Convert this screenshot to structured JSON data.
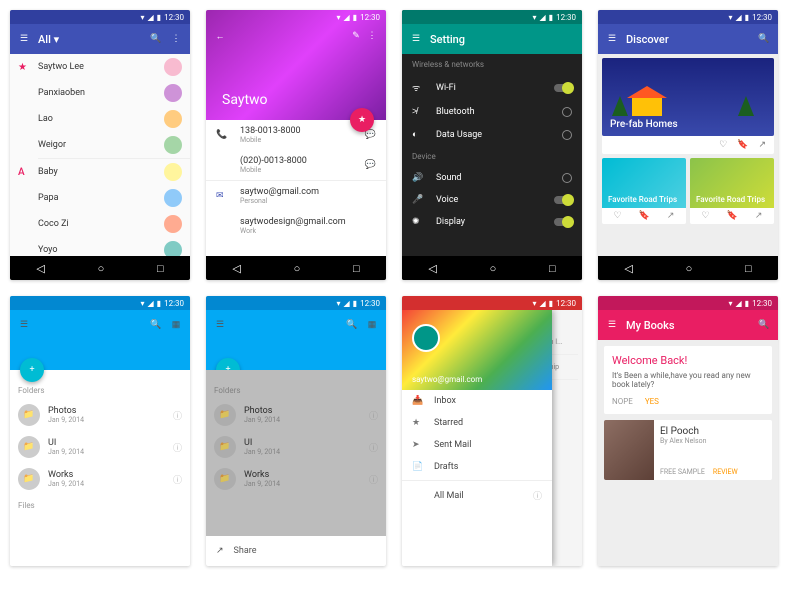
{
  "status": {
    "time": "12:30"
  },
  "s1": {
    "title": "All",
    "contacts": [
      {
        "letter": "★",
        "name": "Saytwo Lee"
      },
      {
        "letter": "",
        "name": "Panxiaoben"
      },
      {
        "letter": "",
        "name": "Lao"
      },
      {
        "letter": "",
        "name": "Weigor"
      },
      {
        "letter": "A",
        "name": "Baby"
      },
      {
        "letter": "",
        "name": "Papa"
      },
      {
        "letter": "",
        "name": "Coco Zi"
      },
      {
        "letter": "",
        "name": "Yoyo"
      }
    ]
  },
  "s2": {
    "name": "Saytwo",
    "phones": [
      {
        "num": "138-0013-8000",
        "type": "Mobile"
      },
      {
        "num": "(020)-0013-8000",
        "type": "Mobile"
      }
    ],
    "emails": [
      {
        "addr": "saytwo@gmail.com",
        "type": "Personal"
      },
      {
        "addr": "saytwodesign@gmail.com",
        "type": "Work"
      }
    ]
  },
  "s3": {
    "title": "Setting",
    "sec1": "Wireless & networks",
    "sec2": "Device",
    "items1": [
      {
        "label": "Wi-Fi",
        "on": true
      },
      {
        "label": "Bluetooth",
        "on": false
      },
      {
        "label": "Data Usage",
        "on": false
      }
    ],
    "items2": [
      {
        "label": "Sound",
        "on": false
      },
      {
        "label": "Voice",
        "on": true
      },
      {
        "label": "Display",
        "on": true
      }
    ]
  },
  "s4": {
    "title": "Discover",
    "card_lg": "Pre-fab Homes",
    "card_sm1": "Favorite Road Trips",
    "card_sm2": "Favorite Road Trips"
  },
  "s5": {
    "section_folders": "Folders",
    "section_files": "Files",
    "folders": [
      {
        "name": "Photos",
        "date": "Jan 9, 2014"
      },
      {
        "name": "UI",
        "date": "Jan 9, 2014"
      },
      {
        "name": "Works",
        "date": "Jan 9, 2014"
      }
    ]
  },
  "s6": {
    "section_folders": "Folders",
    "folders": [
      {
        "name": "Photos",
        "date": "Jan 9, 2014"
      },
      {
        "name": "UI",
        "date": "Jan 9, 2014"
      },
      {
        "name": "Works",
        "date": "Jan 9, 2014"
      }
    ],
    "sheet": {
      "share": "Share"
    }
  },
  "s7": {
    "email": "saytwo@gmail.com",
    "items": [
      "Inbox",
      "Starred",
      "Sent Mail",
      "Drafts"
    ],
    "all_mail": "All Mail",
    "behind": [
      "sh I...",
      "ship"
    ]
  },
  "s8": {
    "title": "My Books",
    "welcome_title": "Welcome Back!",
    "welcome_desc": "It's Been a while,have you read any new book lately?",
    "nope": "NOPE",
    "yes": "YES",
    "book_title": "El Pooch",
    "book_author": "By Alex Nelson",
    "free": "FREE SAMPLE",
    "review": "REVIEW"
  }
}
